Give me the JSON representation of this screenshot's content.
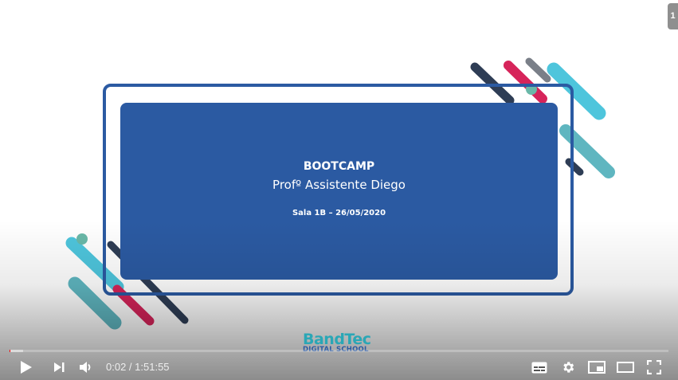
{
  "slide": {
    "title": "BOOTCAMP",
    "subtitle": "Profº Assistente Diego",
    "detail": "Sala 1B – 26/05/2020"
  },
  "logo": {
    "main": "BandTec",
    "sub": "DIGITAL SCHOOL"
  },
  "corner_badge": "1",
  "player": {
    "current_time": "0:02",
    "separator": " / ",
    "duration": "1:51:55",
    "progress_played": 0.0003,
    "progress_loaded": 0.02
  },
  "colors": {
    "slide_blue": "#2b5aa2",
    "frame_blue": "#2b5aa2",
    "accent_cyan": "#4ec5dc",
    "accent_teal": "#5fb6c0",
    "accent_red": "#d6245a",
    "accent_navy": "#2e3d55"
  },
  "icons": {
    "play": "play-icon",
    "next": "next-icon",
    "volume": "volume-icon",
    "subtitles": "subtitles-icon",
    "settings": "gear-icon",
    "miniplayer": "miniplayer-icon",
    "theater": "theater-icon",
    "fullscreen": "fullscreen-icon"
  }
}
